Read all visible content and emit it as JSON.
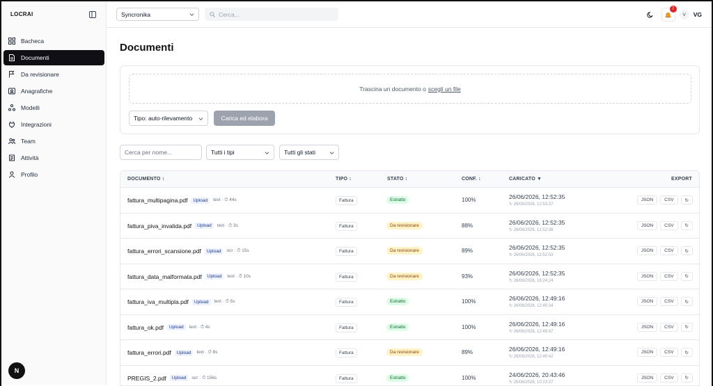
{
  "app": {
    "logo": "LOCRAI"
  },
  "sidebar": {
    "items": [
      {
        "label": "Bacheca",
        "icon": "dashboard-icon",
        "active": false
      },
      {
        "label": "Documenti",
        "icon": "document-icon",
        "active": true
      },
      {
        "label": "Da revisionare",
        "icon": "flag-icon",
        "active": false
      },
      {
        "label": "Anagrafiche",
        "icon": "contact-card-icon",
        "active": false
      },
      {
        "label": "Modelli",
        "icon": "models-icon",
        "active": false
      },
      {
        "label": "Integrazioni",
        "icon": "plug-icon",
        "active": false
      },
      {
        "label": "Team",
        "icon": "team-icon",
        "active": false
      },
      {
        "label": "Attività",
        "icon": "activity-icon",
        "active": false
      },
      {
        "label": "Profilo",
        "icon": "user-icon",
        "active": false
      }
    ],
    "footer_logo": "N"
  },
  "topbar": {
    "company": "Syncronika",
    "search_placeholder": "Cerca...",
    "notifications_count": "7",
    "avatar_letter": "V",
    "initials": "VG"
  },
  "page": {
    "title": "Documenti"
  },
  "upload": {
    "drop_text": "Trascina un documento o",
    "drop_link": "scegli un file",
    "type_select": "Tipo: auto-rilevamento",
    "button": "Carica ed elabora"
  },
  "filters": {
    "name_placeholder": "Cerca per nome...",
    "types": "Tutti i tipi",
    "states": "Tutti gli stati"
  },
  "table": {
    "headers": {
      "documento": "DOCUMENTO ↕",
      "tipo": "TIPO ↕",
      "stato": "STATO ↕",
      "conf": "CONF. ↕",
      "caricato": "CARICATO ▼",
      "export": "EXPORT"
    },
    "rows": [
      {
        "name": "fattura_multipagina.pdf",
        "source": "Upload",
        "meta": "text · ⏱ 44s",
        "tipo": "Fattura",
        "stato": "Estratto",
        "stato_kind": "ok",
        "conf": "100%",
        "caricato": "26/06/2026, 12:52:35",
        "sub": "↻ 26/06/2026, 12:53:37"
      },
      {
        "name": "fattura_piva_invalida.pdf",
        "source": "Upload",
        "meta": "text · ⏱ 3s",
        "tipo": "Fattura",
        "stato": "Da revisionare",
        "stato_kind": "rev",
        "conf": "88%",
        "caricato": "26/06/2026, 12:52:35",
        "sub": "↻ 26/06/2026, 12:52:38"
      },
      {
        "name": "fattura_errori_scansione.pdf",
        "source": "Upload",
        "meta": "ocr · ⏱ 15s",
        "tipo": "Fattura",
        "stato": "Da revisionare",
        "stato_kind": "rev",
        "conf": "89%",
        "caricato": "26/06/2026, 12:52:35",
        "sub": "↻ 26/06/2026, 12:52:53"
      },
      {
        "name": "fattura_data_malformata.pdf",
        "source": "Upload",
        "meta": "text · ⏱ 10s",
        "tipo": "Fattura",
        "stato": "Da revisionare",
        "stato_kind": "rev",
        "conf": "93%",
        "caricato": "26/06/2026, 12:52:35",
        "sub": "↻ 26/06/2026, 16:24:24"
      },
      {
        "name": "fattura_iva_multipla.pdf",
        "source": "Upload",
        "meta": "text · ⏱ 5s",
        "tipo": "Fattura",
        "stato": "Estratto",
        "stato_kind": "ok",
        "conf": "100%",
        "caricato": "26/06/2026, 12:49:16",
        "sub": "↻ 26/06/2026, 12:49:34"
      },
      {
        "name": "fattura_ok.pdf",
        "source": "Upload",
        "meta": "text · ⏱ 4s",
        "tipo": "Fattura",
        "stato": "Estratto",
        "stato_kind": "ok",
        "conf": "100%",
        "caricato": "26/06/2026, 12:49:16",
        "sub": "↻ 26/06/2026, 12:49:47"
      },
      {
        "name": "fattura_errori.pdf",
        "source": "Upload",
        "meta": "text · ⏱ 8s",
        "tipo": "Fattura",
        "stato": "Da revisionare",
        "stato_kind": "rev",
        "conf": "89%",
        "caricato": "26/06/2026, 12:49:16",
        "sub": "↻ 26/06/2026, 12:49:42"
      },
      {
        "name": "PREGIS_2.pdf",
        "source": "Upload",
        "meta": "ocr · ⏱ 156s",
        "tipo": "Fattura",
        "stato": "Estratto",
        "stato_kind": "ok",
        "conf": "100%",
        "caricato": "24/06/2026, 20:43:46",
        "sub": "↻ 25/06/2026, 10:23:27"
      }
    ],
    "export_json": "JSON",
    "export_csv": "CSV",
    "export_retry": "↻"
  }
}
